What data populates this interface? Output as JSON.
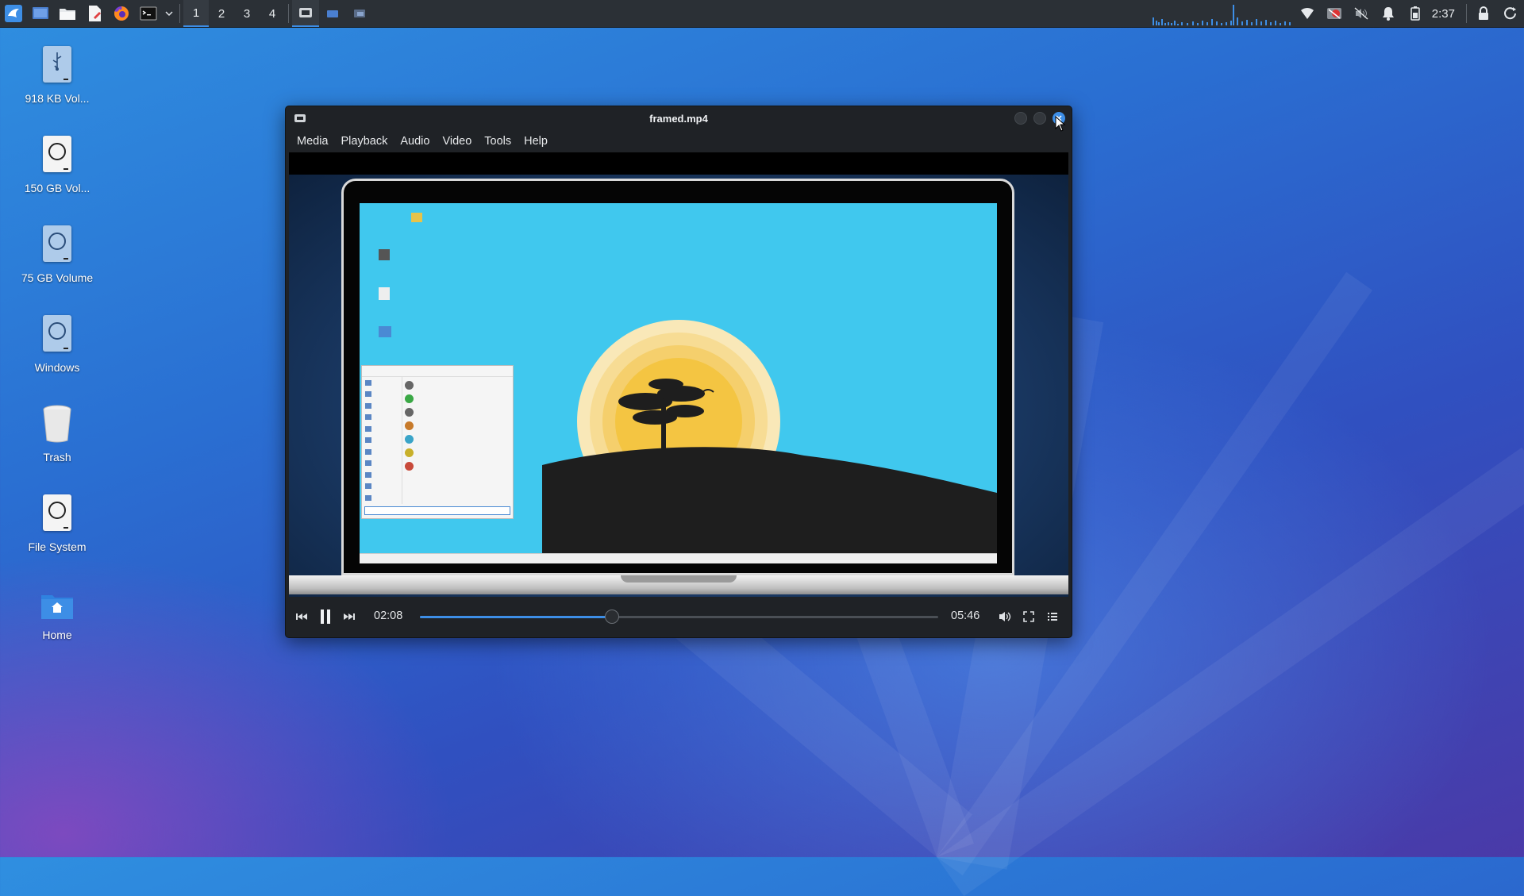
{
  "panel": {
    "workspaces": [
      "1",
      "2",
      "3",
      "4"
    ],
    "active_workspace": "1",
    "launchers": [
      "whisker-menu-icon",
      "show-desktop-icon",
      "file-manager-icon",
      "text-editor-icon",
      "firefox-icon",
      "terminal-icon",
      "chevron-down-icon"
    ],
    "tasks": [
      "media-player-task-icon",
      "window-task-icon",
      "window-task-icon"
    ],
    "tray": [
      "network-icon",
      "screenshot-app-icon",
      "volume-muted-icon",
      "notification-bell-icon",
      "battery-icon",
      "lock-icon",
      "power-icon"
    ],
    "clock": "2:37"
  },
  "desktop_icons": [
    {
      "label": "918 KB Vol...",
      "icon": "usb-drive-icon"
    },
    {
      "label": "150 GB Vol...",
      "icon": "drive-icon"
    },
    {
      "label": "75 GB Volume",
      "icon": "drive-icon"
    },
    {
      "label": "Windows",
      "icon": "drive-icon"
    },
    {
      "label": "Trash",
      "icon": "trash-icon"
    },
    {
      "label": "File System",
      "icon": "drive-icon"
    },
    {
      "label": "Home",
      "icon": "home-folder-icon"
    }
  ],
  "window": {
    "title": "framed.mp4",
    "menu": [
      "Media",
      "Playback",
      "Audio",
      "Video",
      "Tools",
      "Help"
    ],
    "controls": {
      "elapsed": "02:08",
      "duration": "05:46",
      "progress": 0.37
    }
  },
  "colors": {
    "accent": "#3d8ee6",
    "panel": "#2b3036",
    "window_bg": "#1f2226",
    "video_sky": "#40c8ee",
    "sun": "#f4c542"
  }
}
